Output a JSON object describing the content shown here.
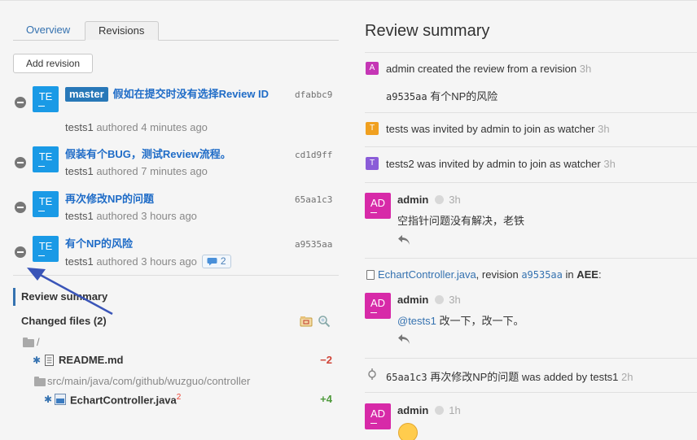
{
  "tabs": {
    "overview": "Overview",
    "revisions": "Revisions"
  },
  "add_revision": "Add revision",
  "revisions": [
    {
      "avatar": "TE",
      "branch": "master",
      "title": "假如在提交时没有选择Review ID",
      "hash": "dfabbc9",
      "author": "tests1",
      "authored": "authored 4 minutes ago"
    },
    {
      "avatar": "TE",
      "title": "假装有个BUG，测试Review流程。",
      "hash": "cd1d9ff",
      "author": "tests1",
      "authored": "authored 7 minutes ago"
    },
    {
      "avatar": "TE",
      "title": "再次修改NP的问题",
      "hash": "65aa1c3",
      "author": "tests1",
      "authored": "authored 3 hours ago"
    },
    {
      "avatar": "TE",
      "title": "有个NP的风险",
      "hash": "a9535aa",
      "author": "tests1",
      "authored": "authored 3 hours ago",
      "comments": "2"
    }
  ],
  "review_summary_label": "Review summary",
  "changed_files_label": "Changed files (2)",
  "files": {
    "root_dir": "/",
    "readme": {
      "name": "README.md",
      "diff": "−2"
    },
    "src_dir": "src/main/java/com/github/wuzguo/controller",
    "echart": {
      "name": "EchartController.java",
      "count": "2",
      "diff": "+4"
    }
  },
  "right": {
    "title": "Review summary",
    "activities": [
      {
        "badge": "A",
        "color": "#c536b5",
        "text": "admin created the review from a revision",
        "time": "3h"
      },
      {
        "hash": "a9535aa",
        "text": "有个NP的风险"
      },
      {
        "badge": "T",
        "color": "#f0a020",
        "text": "tests was invited by admin to join as watcher",
        "time": "3h"
      },
      {
        "badge": "T",
        "color": "#8a5cd8",
        "text": "tests2 was invited by admin to join as watcher",
        "time": "3h"
      }
    ],
    "comment1": {
      "avatar": "AD",
      "author": "admin",
      "time": "3h",
      "text": "空指针问题没有解决，老铁"
    },
    "file_ref": {
      "file": "EchartController.java",
      "mid": ", revision ",
      "hash": "a9535aa",
      "in": " in ",
      "project": "AEE",
      "colon": ":"
    },
    "comment2": {
      "avatar": "AD",
      "author": "admin",
      "time": "3h",
      "mention": "@tests1",
      "text": " 改一下，改一下。"
    },
    "added": {
      "hash": "65aa1c3",
      "title": "再次修改NP的问题",
      "text": "was added by tests1",
      "time": "2h"
    },
    "comment3": {
      "avatar": "AD",
      "author": "admin",
      "time": "1h"
    }
  },
  "colors": {
    "link": "#1f6cc7",
    "avatar_te": "#1a9ae6",
    "avatar_ad": "#d72aa8",
    "branch": "#2878b8",
    "minus": "#d04437",
    "plus": "#4f9a3c"
  }
}
